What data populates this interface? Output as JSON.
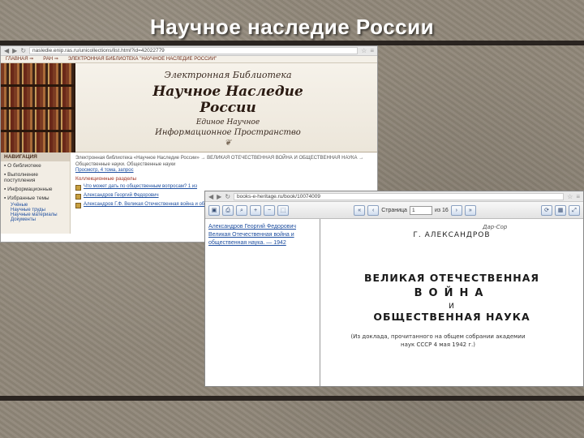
{
  "slide": {
    "title": "Научное наследие России"
  },
  "browser1": {
    "url": "nasledie.enip.ras.ru/unicollections/list.html?id=42022779",
    "topmenu": [
      "ГЛАВНАЯ ⇒",
      "РАН ⇒",
      "ЭЛЕКТРОННАЯ БИБЛИОТЕКА \"НАУЧНОЕ НАСЛЕДИЕ РОССИИ\""
    ],
    "banner": {
      "line1": "Электронная Библиотека",
      "line2": "Научное Наследие России",
      "line3": "Единое Научное",
      "line4": "Информационное Пространство"
    },
    "sidebar": {
      "header": "НАВИГАЦИЯ",
      "items": [
        "О библиотеке",
        "Выполнение поступления",
        "Информационные",
        "Избранные темы"
      ],
      "subitems": [
        "Учёные",
        "Научные труды",
        "Научные материалы",
        "Документы"
      ]
    },
    "main": {
      "crumb": "Электронная библиотека «Научное Наследие России» → ВЕЛИКАЯ ОТЕЧЕСТВЕННАЯ ВОЙНА И ОБЩЕСТВЕННАЯ НАУКА →",
      "crumb2": "Общественные науки. Общественные науки",
      "link": "Просмотр, 4 тома, запрос",
      "section": "Коллекционные разделы",
      "entries": [
        "Что может дать по общественным вопросам? 1 из",
        "Александров Георгий Федорович",
        "Александров Г.Ф. Великая Отечественная война и общественная"
      ]
    }
  },
  "browser2": {
    "url": "books-e-heritage.ru/book/10074009",
    "toolbar": {
      "page_label": "Страница",
      "page_value": "1",
      "of_label": "из 16"
    },
    "leftpane": "Александров Георгий Федорович Великая Отечественная война и общественная наука. — 1942",
    "doc": {
      "author": "Г. АЛЕКСАНДРОВ",
      "stamp": "Дар-Сор",
      "line1": "ВЕЛИКАЯ ОТЕЧЕСТВЕННАЯ",
      "line2": "ВОЙНА",
      "line3": "И",
      "line4": "ОБЩЕСТВЕННАЯ НАУКА",
      "note": "(Из доклада, прочитанного на общем собрании академии наук СССР 4 мая 1942 г.)"
    }
  },
  "colors": {
    "background": "#8f8678",
    "link": "#2050a0",
    "accent": "#a03020"
  }
}
